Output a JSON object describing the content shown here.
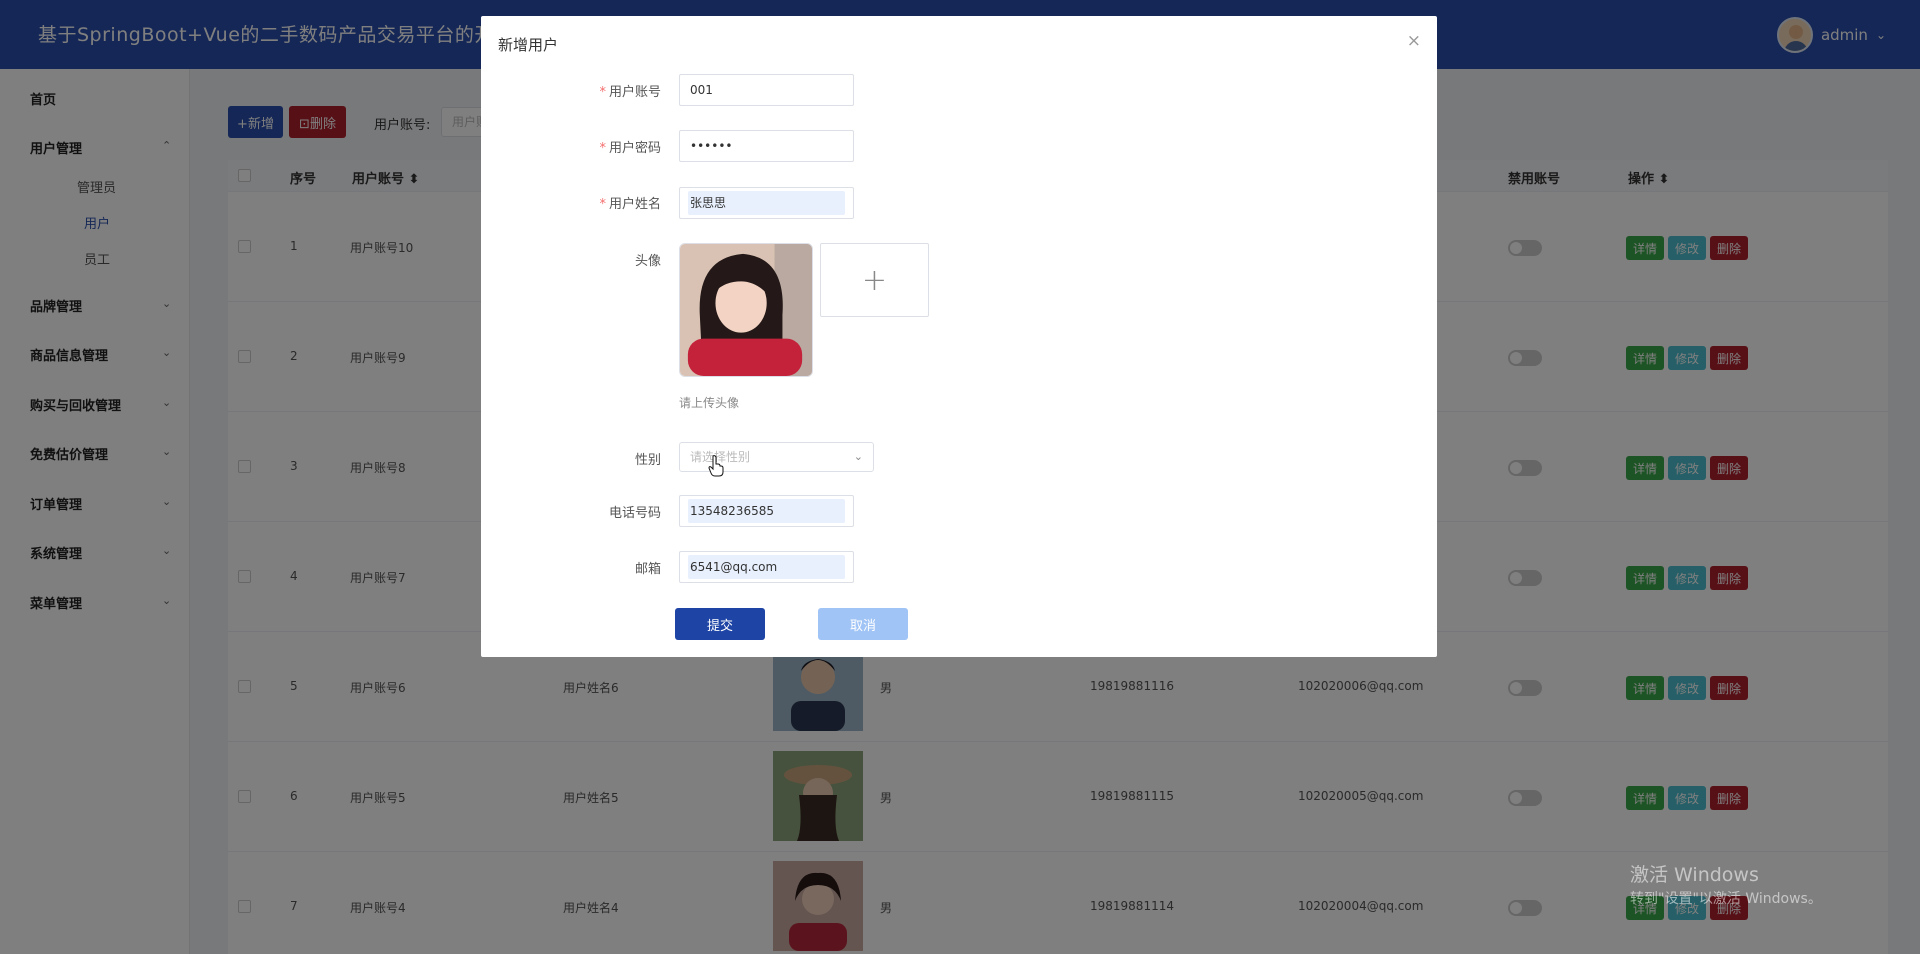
{
  "header": {
    "title": "基于SpringBoot+Vue的二手数码产品交易平台的开发",
    "username": "admin",
    "caret": "⌄"
  },
  "sidebar": {
    "items": [
      {
        "label": "首页"
      },
      {
        "label": "用户管理",
        "arrow": "⌃"
      },
      {
        "label": "品牌管理",
        "arrow": "⌄"
      },
      {
        "label": "商品信息管理",
        "arrow": "⌄"
      },
      {
        "label": "购买与回收管理",
        "arrow": "⌄"
      },
      {
        "label": "免费估价管理",
        "arrow": "⌄"
      },
      {
        "label": "订单管理",
        "arrow": "⌄"
      },
      {
        "label": "系统管理",
        "arrow": "⌄"
      },
      {
        "label": "菜单管理",
        "arrow": "⌄"
      }
    ],
    "sub_items": [
      {
        "label": "管理员"
      },
      {
        "label": "用户",
        "active": true
      },
      {
        "label": "员工"
      }
    ]
  },
  "toolbar": {
    "add_label": "+新增",
    "delete_label": "⊡删除",
    "search_label": "用户账号:",
    "search_placeholder": "用户账"
  },
  "table": {
    "headers": {
      "index": "序号",
      "account": "用户账号 ⬍",
      "disabled": "禁用账号",
      "actions": "操作 ⬍"
    },
    "rows": [
      {
        "index": "1",
        "account": "用户账号10",
        "name": "",
        "gender": "",
        "phone": "",
        "email": ""
      },
      {
        "index": "2",
        "account": "用户账号9",
        "name": "",
        "gender": "",
        "phone": "",
        "email": ""
      },
      {
        "index": "3",
        "account": "用户账号8",
        "name": "",
        "gender": "",
        "phone": "",
        "email": ""
      },
      {
        "index": "4",
        "account": "用户账号7",
        "name": "",
        "gender": "",
        "phone": "",
        "email": ""
      },
      {
        "index": "5",
        "account": "用户账号6",
        "name": "用户姓名6",
        "gender": "男",
        "phone": "19819881116",
        "email": "102020006@qq.com"
      },
      {
        "index": "6",
        "account": "用户账号5",
        "name": "用户姓名5",
        "gender": "男",
        "phone": "19819881115",
        "email": "102020005@qq.com"
      },
      {
        "index": "7",
        "account": "用户账号4",
        "name": "用户姓名4",
        "gender": "男",
        "phone": "19819881114",
        "email": "102020004@qq.com"
      }
    ],
    "action_labels": {
      "detail": "详情",
      "edit": "修改",
      "delete": "删除"
    }
  },
  "dialog": {
    "title": "新增用户",
    "close": "×",
    "fields": {
      "account": {
        "label": "用户账号",
        "value": "001"
      },
      "password": {
        "label": "用户密码",
        "value": "••••••"
      },
      "name": {
        "label": "用户姓名",
        "value": "张思思"
      },
      "avatar": {
        "label": "头像",
        "add": "+",
        "tip": "请上传头像"
      },
      "gender": {
        "label": "性别",
        "placeholder": "请选择性别",
        "chev": "⌄"
      },
      "phone": {
        "label": "电话号码",
        "value": "13548236585"
      },
      "email": {
        "label": "邮箱",
        "value": "6541@qq.com"
      }
    },
    "submit": "提交",
    "cancel": "取消"
  },
  "watermark": {
    "line1": "激活 Windows",
    "line2": "转到\"设置\"以激活 Windows。"
  },
  "colors": {
    "primary": "#2b4fad",
    "danger": "#b0202e",
    "success": "#3aa84a",
    "info": "#4dbfcf",
    "cancel": "#a0c4f5"
  }
}
